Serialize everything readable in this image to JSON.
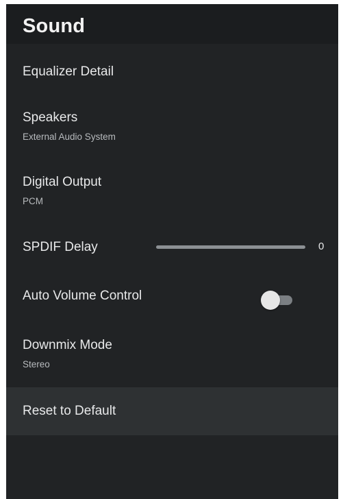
{
  "header": {
    "title": "Sound"
  },
  "items": [
    {
      "label": "Equalizer Detail"
    },
    {
      "label": "Speakers",
      "sub": "External Audio System"
    },
    {
      "label": "Digital Output",
      "sub": "PCM"
    },
    {
      "label": "SPDIF Delay",
      "value": "0"
    },
    {
      "label": "Auto Volume Control",
      "toggle_on": false
    },
    {
      "label": "Downmix Mode",
      "sub": "Stereo"
    },
    {
      "label": "Reset to Default",
      "focused": true
    }
  ],
  "colors": {
    "background": "#212325",
    "header_background": "#1b1d1f",
    "focused_row": "#2e3133",
    "text": "#e8e9ea",
    "subtext": "#b8bbbe",
    "slider_track": "#8c9094",
    "toggle_track": "#7b7f83",
    "toggle_thumb": "#e6e6e6"
  },
  "icons": {
    "toggle": "toggle-switch-off"
  }
}
